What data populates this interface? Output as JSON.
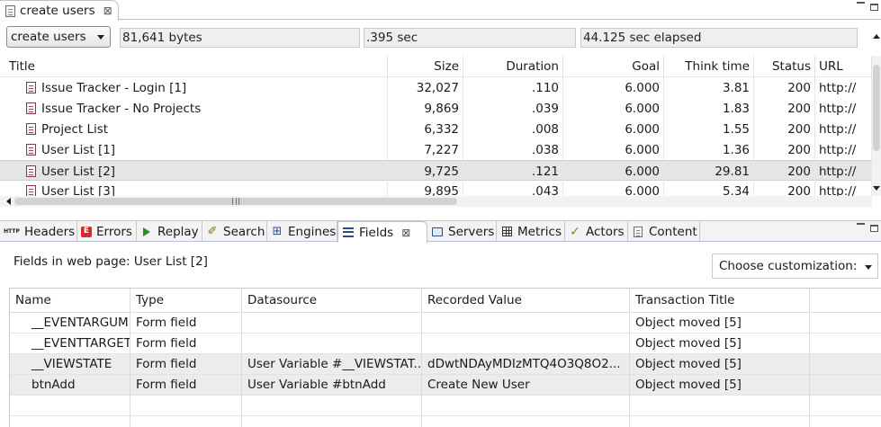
{
  "editor_tab": {
    "title": "create users",
    "close": "⊠"
  },
  "toolbar": {
    "transaction": "create users",
    "bytes": "81,641 bytes",
    "duration": ".395 sec",
    "elapsed": "44.125 sec elapsed"
  },
  "pages_table": {
    "headers": {
      "title": "Title",
      "size": "Size",
      "duration": "Duration",
      "goal": "Goal",
      "think": "Think time",
      "status": "Status",
      "url": "URL"
    },
    "rows": [
      {
        "title": "Issue Tracker - Login [1]",
        "size": "32,027",
        "duration": ".110",
        "goal": "6.000",
        "think": "3.81",
        "status": "200",
        "url": "http://"
      },
      {
        "title": "Issue Tracker - No Projects",
        "size": "9,869",
        "duration": ".039",
        "goal": "6.000",
        "think": "1.83",
        "status": "200",
        "url": "http://"
      },
      {
        "title": "Project List",
        "size": "6,332",
        "duration": ".008",
        "goal": "6.000",
        "think": "1.55",
        "status": "200",
        "url": "http://"
      },
      {
        "title": "User List [1]",
        "size": "7,227",
        "duration": ".038",
        "goal": "6.000",
        "think": "1.36",
        "status": "200",
        "url": "http://"
      },
      {
        "title": "User List [2]",
        "size": "9,725",
        "duration": ".121",
        "goal": "6.000",
        "think": "29.81",
        "status": "200",
        "url": "http://"
      },
      {
        "title": "User List [3]",
        "size": "9,895",
        "duration": ".043",
        "goal": "6.000",
        "think": "5.34",
        "status": "200",
        "url": "http://"
      }
    ],
    "selected_index": 4
  },
  "view_tabs": [
    {
      "label": "Headers",
      "icon": "http-icon"
    },
    {
      "label": "Errors",
      "icon": "errors-icon"
    },
    {
      "label": "Replay",
      "icon": "replay-icon"
    },
    {
      "label": "Search",
      "icon": "search-icon"
    },
    {
      "label": "Engines",
      "icon": "engines-icon"
    },
    {
      "label": "Fields",
      "icon": "fields-icon",
      "active": true,
      "close": "⊠"
    },
    {
      "label": "Servers",
      "icon": "servers-icon"
    },
    {
      "label": "Metrics",
      "icon": "metrics-icon"
    },
    {
      "label": "Actors",
      "icon": "actors-icon"
    },
    {
      "label": "Content",
      "icon": "content-icon"
    }
  ],
  "fields_panel": {
    "caption": "Fields in web page: User List [2]",
    "customization": "Choose customization:",
    "headers": {
      "name": "Name",
      "type": "Type",
      "datasource": "Datasource",
      "recorded": "Recorded Value",
      "transaction": "Transaction Title"
    },
    "rows": [
      {
        "name": "__EVENTARGUM",
        "type": "Form field",
        "datasource": "",
        "recorded": "",
        "transaction": "Object moved [5]"
      },
      {
        "name": "__EVENTTARGET",
        "type": "Form field",
        "datasource": "",
        "recorded": "",
        "transaction": "Object moved [5]"
      },
      {
        "name": "__VIEWSTATE",
        "type": "Form field",
        "datasource": "User Variable #__VIEWSTAT...",
        "recorded": "dDwtNDAyMDIzMTQ4O3Q8O2...",
        "transaction": "Object moved [5]"
      },
      {
        "name": "btnAdd",
        "type": "Form field",
        "datasource": "User Variable #btnAdd",
        "recorded": "Create New User",
        "transaction": "Object moved [5]"
      }
    ]
  }
}
